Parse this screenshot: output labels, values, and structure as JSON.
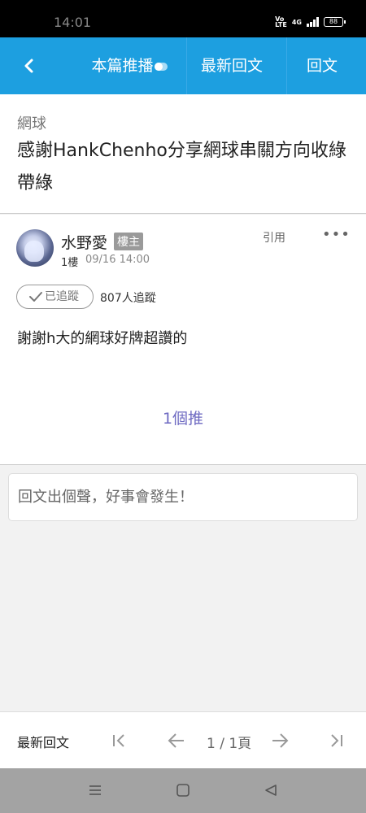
{
  "status": {
    "time": "14:01",
    "volte_label": "Vo LTE",
    "network_label": "4G",
    "battery": "88"
  },
  "nav": {
    "push_label": "本篇推播",
    "latest_label": "最新回文",
    "reply_label": "回文"
  },
  "thread": {
    "board": "網球",
    "title": "感謝HankChenho分享網球串關方向收綠帶綠"
  },
  "post": {
    "author": "水野愛",
    "badge": "樓主",
    "floor": "1樓",
    "time": "09/16 14:00",
    "quote_label": "引用",
    "more_label": "•••",
    "follow_label": "已追蹤",
    "followers": "807人追蹤",
    "content": "謝謝h大的網球好牌超讚的",
    "push_count": "1個推"
  },
  "reply": {
    "placeholder": "回文出個聲，好事會發生！"
  },
  "bottom": {
    "latest_label": "最新回文",
    "page": "1 / 1頁"
  },
  "colors": {
    "nav_bg": "#1d9fe0",
    "push_text": "#6e6ac2",
    "sysnav_bg": "#a3a3a3"
  }
}
